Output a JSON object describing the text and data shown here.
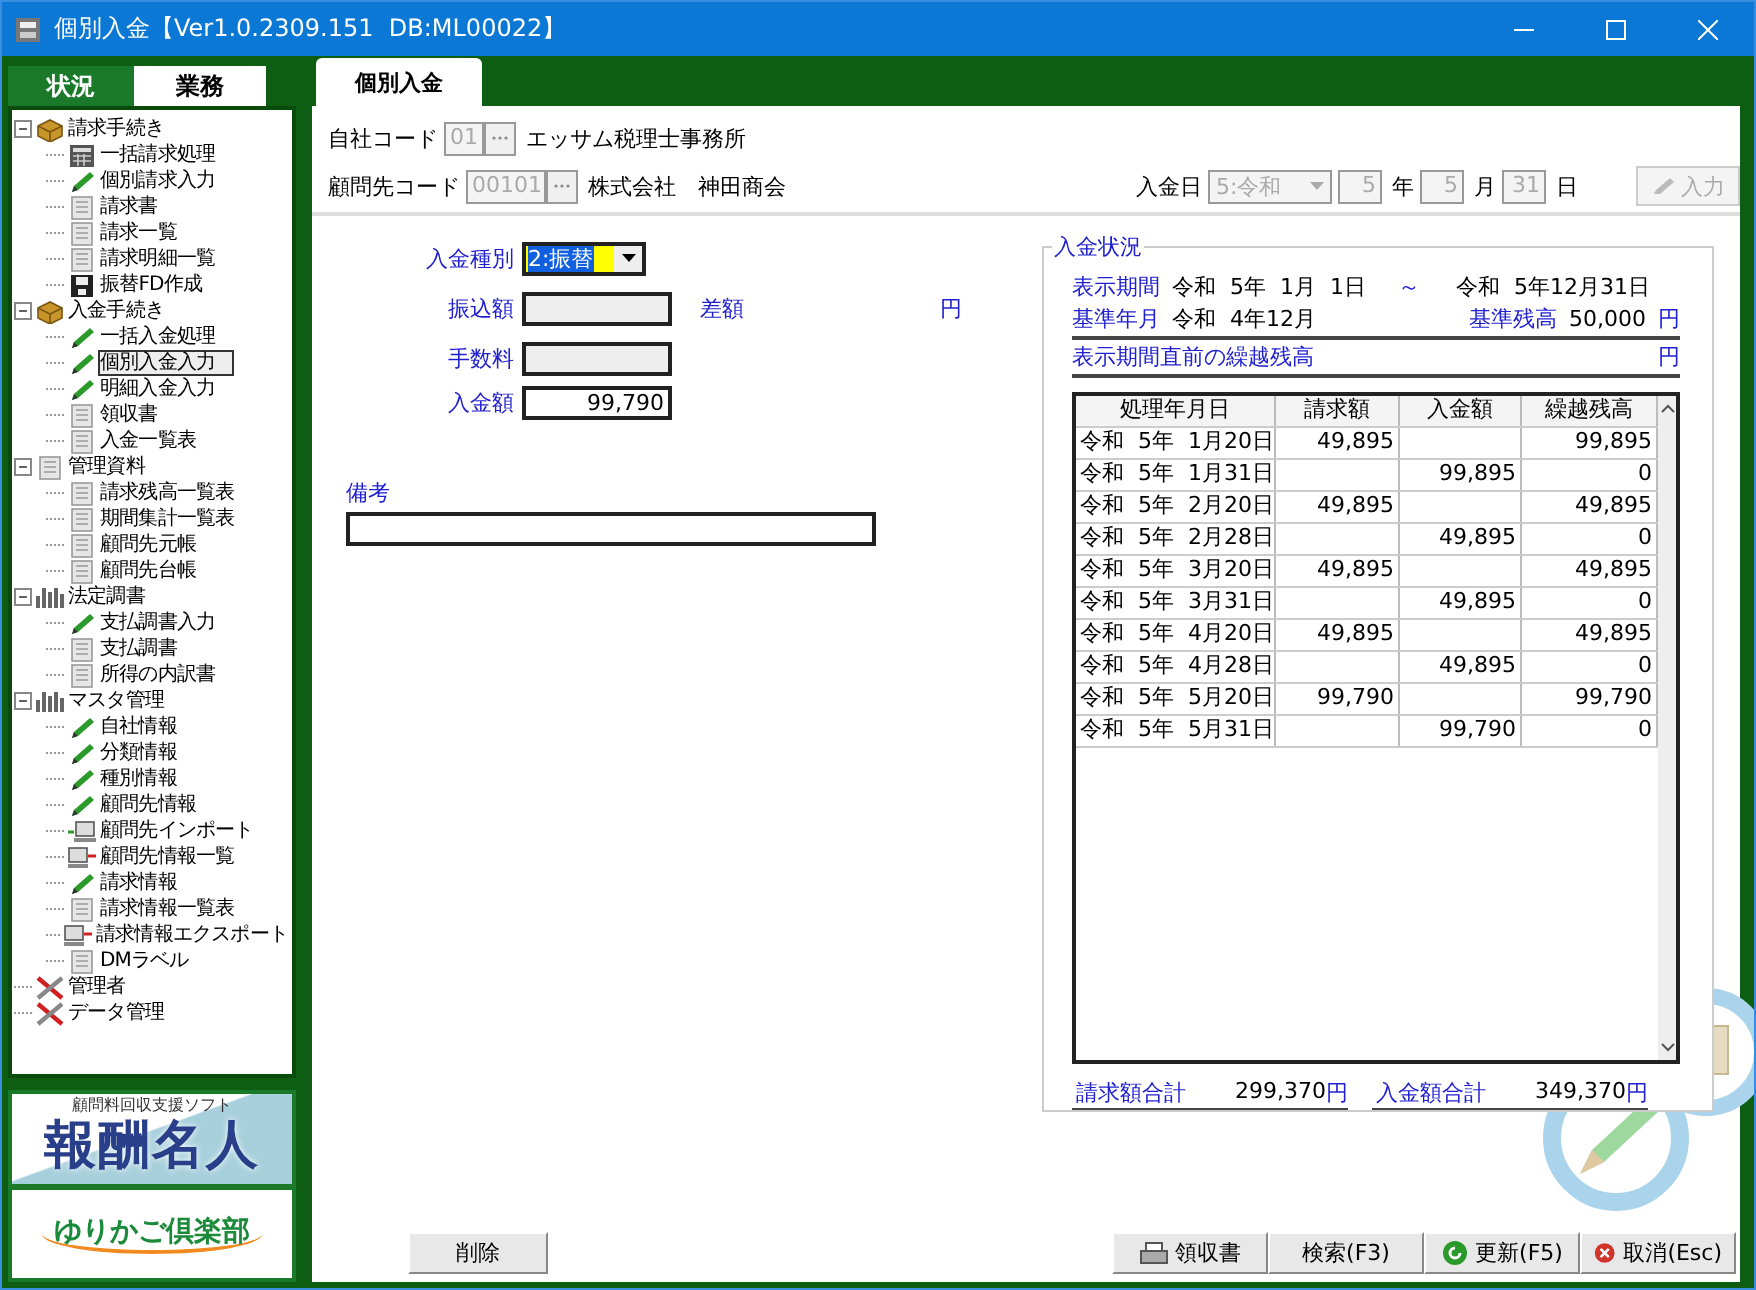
{
  "window": {
    "title": "個別入金【Ver1.0.2309.151  DB:ML00022】"
  },
  "sidebar": {
    "tabs": [
      {
        "label": "状況",
        "selected": false
      },
      {
        "label": "業務",
        "selected": true
      }
    ],
    "tree": [
      {
        "label": "請求手続き",
        "kind": "folder",
        "expanded": true,
        "selected": false,
        "children": [
          {
            "label": "一括請求処理",
            "kind": "calc",
            "selected": false
          },
          {
            "label": "個別請求入力",
            "kind": "pencil",
            "selected": false
          },
          {
            "label": "請求書",
            "kind": "doc",
            "selected": false
          },
          {
            "label": "請求一覧",
            "kind": "doc",
            "selected": false
          },
          {
            "label": "請求明細一覧",
            "kind": "doc",
            "selected": false
          },
          {
            "label": "振替FD作成",
            "kind": "disk",
            "selected": false
          }
        ]
      },
      {
        "label": "入金手続き",
        "kind": "folder",
        "expanded": true,
        "selected": false,
        "children": [
          {
            "label": "一括入金処理",
            "kind": "pencil",
            "selected": false
          },
          {
            "label": "個別入金入力",
            "kind": "pencil",
            "selected": true
          },
          {
            "label": "明細入金入力",
            "kind": "pencil",
            "selected": false
          },
          {
            "label": "領収書",
            "kind": "doc",
            "selected": false
          },
          {
            "label": "入金一覧表",
            "kind": "doc",
            "selected": false
          }
        ]
      },
      {
        "label": "管理資料",
        "kind": "doc",
        "expanded": true,
        "selected": false,
        "children": [
          {
            "label": "請求残高一覧表",
            "kind": "doc",
            "selected": false
          },
          {
            "label": "期間集計一覧表",
            "kind": "doc",
            "selected": false
          },
          {
            "label": "顧問先元帳",
            "kind": "doc",
            "selected": false
          },
          {
            "label": "顧問先台帳",
            "kind": "doc",
            "selected": false
          }
        ]
      },
      {
        "label": "法定調書",
        "kind": "chart",
        "expanded": true,
        "selected": false,
        "children": [
          {
            "label": "支払調書入力",
            "kind": "pencil",
            "selected": false
          },
          {
            "label": "支払調書",
            "kind": "doc",
            "selected": false
          },
          {
            "label": "所得の内訳書",
            "kind": "doc",
            "selected": false
          }
        ]
      },
      {
        "label": "マスタ管理",
        "kind": "chart",
        "expanded": true,
        "selected": false,
        "children": [
          {
            "label": "自社情報",
            "kind": "pencil",
            "selected": false
          },
          {
            "label": "分類情報",
            "kind": "pencil",
            "selected": false
          },
          {
            "label": "種別情報",
            "kind": "pencil",
            "selected": false
          },
          {
            "label": "顧問先情報",
            "kind": "pencil",
            "selected": false
          },
          {
            "label": "顧問先インポート",
            "kind": "import",
            "selected": false
          },
          {
            "label": "顧問先情報一覧",
            "kind": "export",
            "selected": false
          },
          {
            "label": "請求情報",
            "kind": "pencil",
            "selected": false
          },
          {
            "label": "請求情報一覧表",
            "kind": "doc",
            "selected": false
          },
          {
            "label": "請求情報エクスポート",
            "kind": "export",
            "selected": false
          },
          {
            "label": "DMラベル",
            "kind": "doc",
            "selected": false
          }
        ]
      },
      {
        "label": "管理者",
        "kind": "tools",
        "selected": false
      },
      {
        "label": "データ管理",
        "kind": "tools",
        "selected": false
      }
    ],
    "logo": {
      "caption": "顧問料回収支援ソフト",
      "title": "報酬名人",
      "club": "ゆりかご倶楽部"
    }
  },
  "tabs": [
    {
      "label": "個別入金",
      "selected": true
    }
  ],
  "header": {
    "company": {
      "label": "自社コード",
      "value": "01",
      "disabled": true,
      "name": "エッサム税理士事務所"
    },
    "client": {
      "label": "顧問先コード",
      "value": "00101",
      "disabled": true,
      "name": "株式会社　神田商会"
    },
    "date": {
      "label": "入金日",
      "era": "5:令和",
      "year": "5",
      "year_unit": "年",
      "month": "5",
      "month_unit": "月",
      "day": "31",
      "day_unit": "日",
      "disabled": true
    },
    "input_button": {
      "label": "入力",
      "disabled": true
    }
  },
  "form": {
    "type": {
      "label": "入金種別",
      "value": "2:振替"
    },
    "transfer": {
      "label": "振込額",
      "disabled": true
    },
    "difference": {
      "label": "差額",
      "unit": "円"
    },
    "fee": {
      "label": "手数料",
      "disabled": true
    },
    "amount": {
      "label": "入金額",
      "value": "99,790",
      "disabled": false
    },
    "note": {
      "label": "備考"
    }
  },
  "status": {
    "title": "入金状況",
    "period": {
      "label": "表示期間",
      "from": "令和  5年  1月  1日",
      "sep": "～",
      "to": "令和  5年12月31日"
    },
    "base_month": {
      "label": "基準年月",
      "value": "令和  4年12月"
    },
    "base_balance": {
      "label": "基準残高",
      "value": "50,000",
      "unit": "円"
    },
    "carry": {
      "label": "表示期間直前の繰越残高",
      "unit": "円"
    },
    "table": {
      "columns": [
        "処理年月日",
        "請求額",
        "入金額",
        "繰越残高"
      ],
      "rows": [
        {
          "date": "令和  5年  1月20日",
          "billed": "49,895",
          "balance": "99,895"
        },
        {
          "date": "令和  5年  1月31日",
          "paid": "99,895",
          "balance": "0"
        },
        {
          "date": "令和  5年  2月20日",
          "billed": "49,895",
          "balance": "49,895"
        },
        {
          "date": "令和  5年  2月28日",
          "paid": "49,895",
          "balance": "0"
        },
        {
          "date": "令和  5年  3月20日",
          "billed": "49,895",
          "balance": "49,895"
        },
        {
          "date": "令和  5年  3月31日",
          "paid": "49,895",
          "balance": "0"
        },
        {
          "date": "令和  5年  4月20日",
          "billed": "49,895",
          "balance": "49,895"
        },
        {
          "date": "令和  5年  4月28日",
          "paid": "49,895",
          "balance": "0"
        },
        {
          "date": "令和  5年  5月20日",
          "billed": "99,790",
          "balance": "99,790"
        },
        {
          "date": "令和  5年  5月31日",
          "paid": "99,790",
          "balance": "0"
        }
      ]
    },
    "totals": [
      {
        "label": "請求額合計",
        "value": "299,370",
        "unit": "円"
      },
      {
        "label": "入金額合計",
        "value": "349,370",
        "unit": "円"
      }
    ]
  },
  "delete_button": {
    "label": "削除"
  },
  "actions": [
    {
      "label": "領収書",
      "kind": "print"
    },
    {
      "label": "検索(F3)",
      "kind": "plain"
    },
    {
      "label": "更新(F5)",
      "kind": "refresh"
    },
    {
      "label": "取消(Esc)",
      "kind": "cancel"
    }
  ]
}
